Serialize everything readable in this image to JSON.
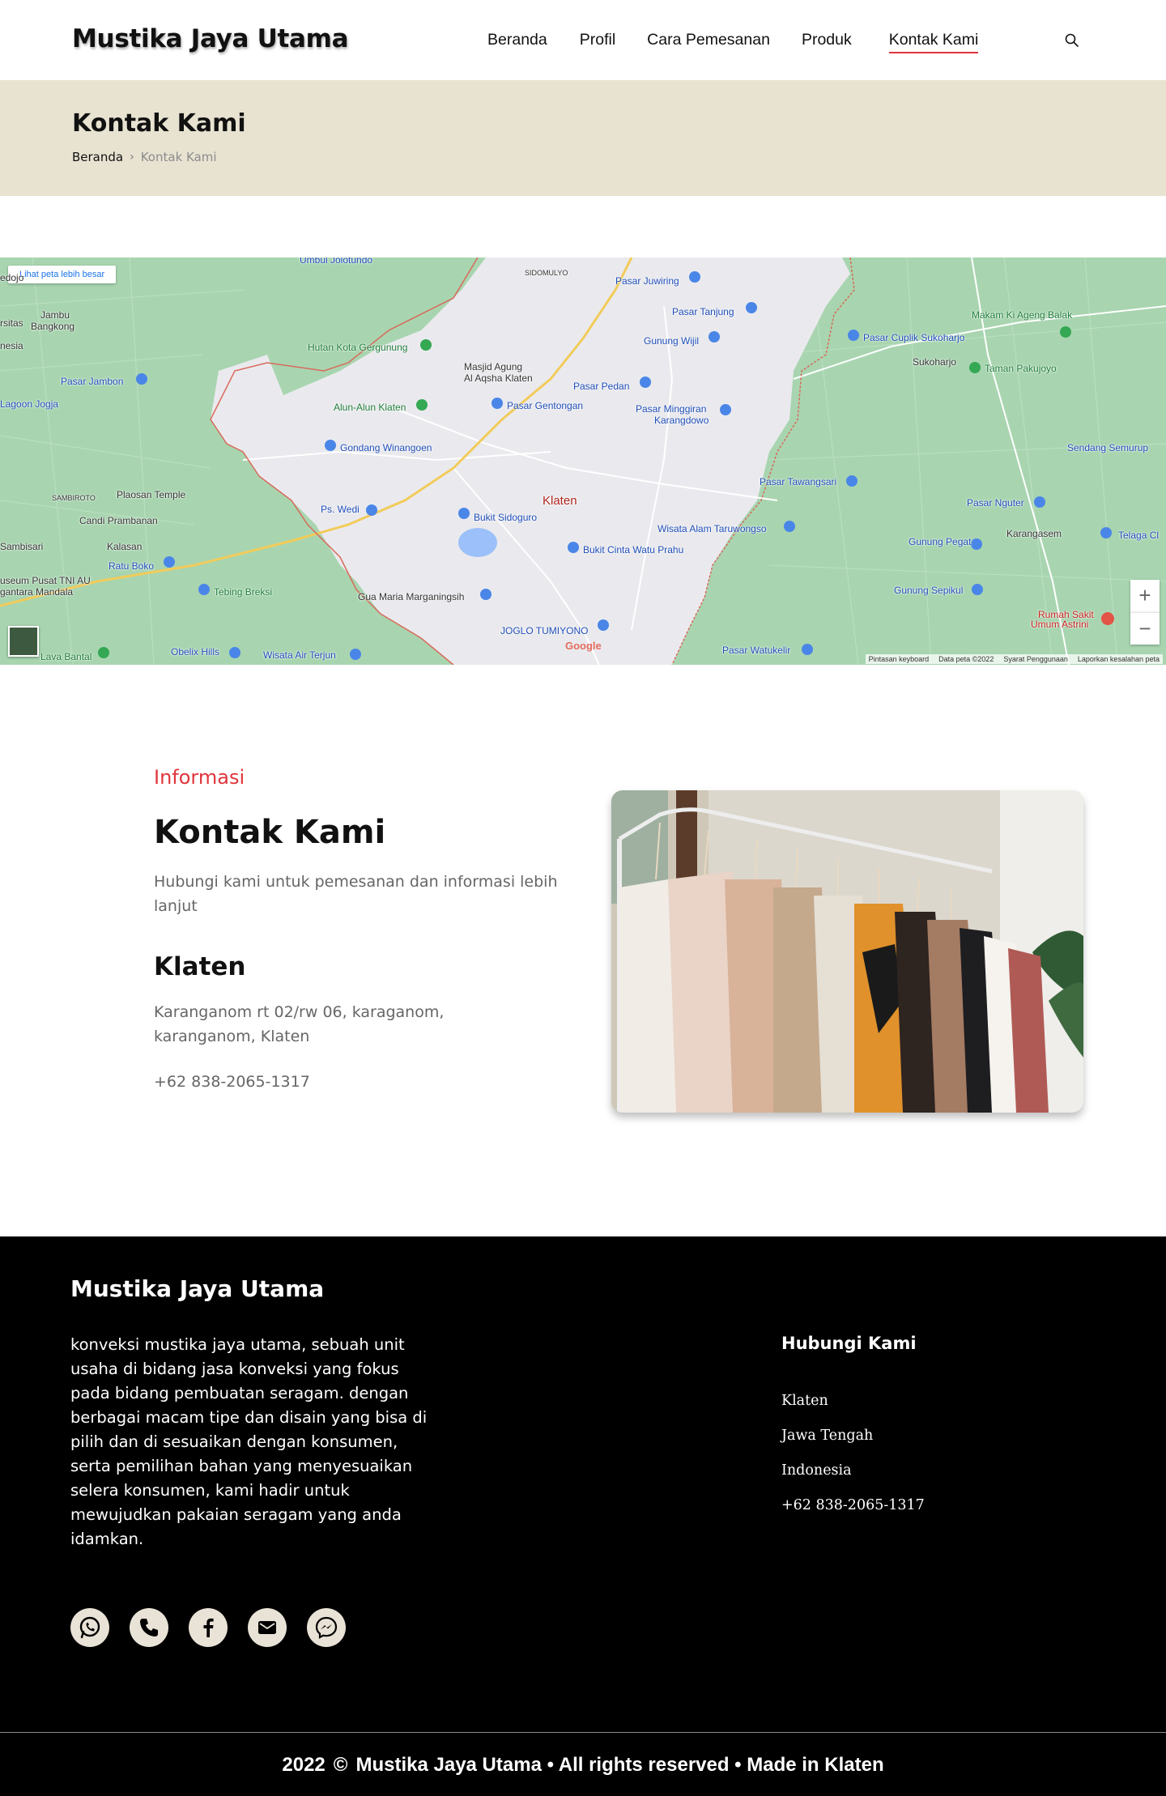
{
  "header": {
    "brand": "Mustika Jaya Utama",
    "nav": [
      {
        "label": "Beranda"
      },
      {
        "label": "Profil"
      },
      {
        "label": "Cara Pemesanan"
      },
      {
        "label": "Produk"
      },
      {
        "label": "Kontak Kami",
        "active": true
      }
    ],
    "search_icon": "search-icon"
  },
  "banner": {
    "title": "Kontak Kami",
    "breadcrumb": {
      "home": "Beranda",
      "separator": "›",
      "current": "Kontak Kami"
    }
  },
  "map": {
    "larger_map_link": "Lihat peta lebih besar",
    "city": "Klaten",
    "labels": [
      "Umbul Jolotundo",
      "SIDOMULYO",
      "Pasar Juwiring",
      "Pasar Tanjung",
      "Gunung Wijil",
      "Makam Ki Ageng Balak",
      "Pasar Cuplik Sukoharjo",
      "Sukoharjo",
      "Taman Pakujoyo",
      "Jambu",
      "Bangkong",
      "Hutan Kota Gergunung",
      "Masjid Agung",
      "Al Aqsha Klaten",
      "Pasar Pedan",
      "Pasar Jambon",
      "Lagoon Jogja",
      "Alun-Alun Klaten",
      "Pasar Gentongan",
      "Pasar Minggiran",
      "Karangdowo",
      "Gondang Winangoen",
      "Sendang Semurup",
      "SAMBIROTO",
      "Plaosan Temple",
      "Pasar Tawangsari",
      "Pasar Nguter",
      "Ps. Wedi",
      "Bukit Sidoguro",
      "Candi Prambanan",
      "Karangasem",
      "Wisata Alam Taruwongso",
      "Sambisari",
      "Kalasan",
      "Ratu Boko",
      "Bukit Cinta Watu Prahu",
      "Gunung Pegat",
      "Telaga Cl",
      "useum Pusat TNI AU",
      "gantara Mandala",
      "Tebing Breksi",
      "Gua Maria Marganingsih",
      "Gunung Sepikul",
      "Rumah Sakit",
      "Umum Astrini",
      "JOGLO TUMIYONO",
      "Lava Bantal",
      "Obelix Hills",
      "Wisata Air Terjun",
      "Pasar Watukelir",
      "edojo",
      "rsitas",
      "nesia"
    ],
    "brand": "Google",
    "attribution": [
      "Pintasan keyboard",
      "Data peta ©2022",
      "Syarat Penggunaan",
      "Laporkan kesalahan peta"
    ],
    "zoom_in": "+",
    "zoom_out": "−"
  },
  "info": {
    "kicker": "Informasi",
    "title": "Kontak Kami",
    "description": "Hubungi kami untuk pemesanan dan informasi lebih lanjut",
    "city": "Klaten",
    "address": "Karanganom rt 02/rw 06, karaganom, karanganom, Klaten",
    "phone": "+62 838-2065-1317"
  },
  "footer": {
    "brand": "Mustika Jaya Utama",
    "about": "konveksi mustika jaya utama, sebuah unit usaha di bidang jasa konveksi yang fokus pada bidang pembuatan seragam. dengan berbagai macam tipe dan disain yang bisa di pilih dan di sesuaikan dengan konsumen, serta pemilihan bahan yang menyesuaikan selera konsumen, kami hadir untuk mewujudkan pakaian seragam yang anda idamkan.",
    "contact_title": "Hubungi Kami",
    "contact_items": [
      "Klaten",
      "Jawa Tengah",
      "Indonesia",
      "+62 838-2065-1317"
    ],
    "socials": [
      "whatsapp-icon",
      "phone-icon",
      "facebook-icon",
      "email-icon",
      "messenger-icon"
    ],
    "copyright": {
      "year": "2022",
      "symbol": "©",
      "text": "Mustika Jaya Utama • All rights reserved • Made in Klaten"
    }
  },
  "colors": {
    "accent": "#e0353b",
    "banner_bg": "#e8e3d1",
    "footer_bg": "#000000",
    "social_bg": "#e9e2d6"
  }
}
